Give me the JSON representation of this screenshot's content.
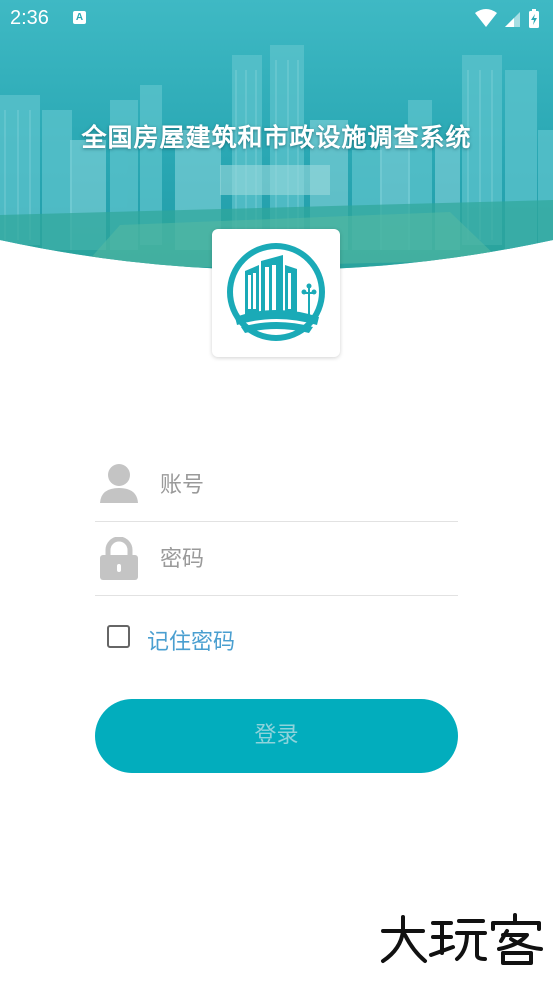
{
  "status_bar": {
    "time": "2:36",
    "notification_icon_letter": "A",
    "icons": [
      "wifi-icon",
      "signal-icon",
      "battery-charging-icon"
    ]
  },
  "header": {
    "title": "全国房屋建筑和市政设施调查系统",
    "background_color": "#2aa8b4"
  },
  "logo": {
    "icon": "building-logo-icon",
    "color": "#1aaab7"
  },
  "form": {
    "username_placeholder": "账号",
    "password_placeholder": "密码",
    "remember_label": "记住密码",
    "remember_checked": false,
    "login_label": "登录"
  },
  "colors": {
    "accent": "#02adbd",
    "link": "#4a9fd0",
    "icon_gray": "#c4c4c4"
  }
}
